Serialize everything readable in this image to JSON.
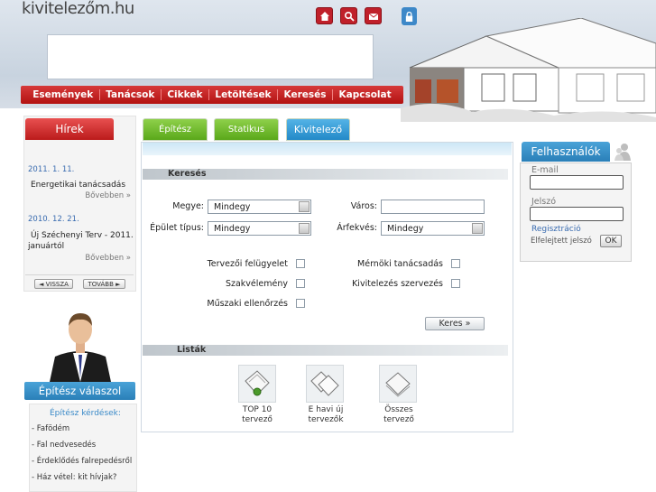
{
  "site": {
    "logo": "kivitelezőm.hu"
  },
  "nav": {
    "items": [
      "Események",
      "Tanácsok",
      "Cikkek",
      "Letöltések",
      "Keresés",
      "Kapcsolat"
    ]
  },
  "news": {
    "tab": "Hírek",
    "items": [
      {
        "date": "2011. 1. 11.",
        "title": "Energetikai tanácsadás",
        "more": "Bővebben »"
      },
      {
        "date": "2010. 12. 21.",
        "title_line1": "Új Széchenyi Terv - 2011.",
        "title_line2": "januártól",
        "more": "Bővebben »"
      }
    ],
    "prev": "◄ VISSZA",
    "next": "TOVÁBB ►"
  },
  "expert": {
    "tab": "Építész válaszol",
    "questions_title": "Építész kérdések:",
    "questions": [
      "- Fafödém",
      "- Fal nedvesedés",
      "- Érdeklődés falrepedésről",
      "- Ház vétel: kit hívjak?"
    ]
  },
  "categories": {
    "tab1": "Építész",
    "tab2": "Statikus",
    "tab3": "Kivitelező"
  },
  "search": {
    "title": "Keresés",
    "county_label": "Megye:",
    "county_value": "Mindegy",
    "city_label": "Város:",
    "city_value": "",
    "building_label": "Épület típus:",
    "building_value": "Mindegy",
    "price_label": "Árfekvés:",
    "price_value": "Mindegy",
    "checks": {
      "c1": "Tervezői felügyelet",
      "c2": "Mérnöki tanácsadás",
      "c3": "Szakvélemény",
      "c4": "Kivitelezés szervezés",
      "c5": "Műszaki ellenőrzés"
    },
    "button": "Keres »"
  },
  "lists": {
    "title": "Listák",
    "items": [
      {
        "line1": "TOP 10",
        "line2": "tervező"
      },
      {
        "line1": "E havi új",
        "line2": "tervezők"
      },
      {
        "line1": "Összes",
        "line2": "tervező"
      }
    ]
  },
  "users": {
    "tab": "Felhasználók",
    "email_label": "E-mail",
    "password_label": "Jelszó",
    "register": "Regisztráció",
    "forgot": "Elfelejtett jelszó",
    "ok": "OK"
  },
  "colors": {
    "nav_red": "#c0202a",
    "accent_blue": "#2a7fb8",
    "green_tab": "#6bb82a"
  }
}
